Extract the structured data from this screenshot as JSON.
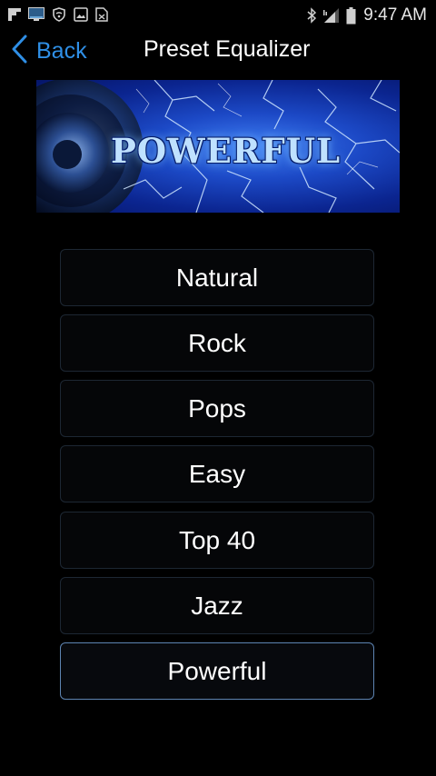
{
  "status_bar": {
    "time": "9:47 AM",
    "left_icons": [
      "flipboard-icon",
      "monitor-icon",
      "shield-icon",
      "image-icon",
      "file-icon"
    ],
    "right_icons": [
      "bluetooth-icon",
      "signal-icon",
      "battery-icon"
    ]
  },
  "header": {
    "back_label": "Back",
    "title": "Preset Equalizer"
  },
  "banner": {
    "text": "POWERFUL"
  },
  "presets": [
    {
      "label": "Natural",
      "selected": false
    },
    {
      "label": "Rock",
      "selected": false
    },
    {
      "label": "Pops",
      "selected": false
    },
    {
      "label": "Easy",
      "selected": false
    },
    {
      "label": "Top 40",
      "selected": false
    },
    {
      "label": "Jazz",
      "selected": false
    },
    {
      "label": "Powerful",
      "selected": true
    }
  ],
  "colors": {
    "background": "#000000",
    "accent": "#2f8fe6",
    "selected_border": "#5d84b2",
    "button_border": "#1d2733"
  }
}
